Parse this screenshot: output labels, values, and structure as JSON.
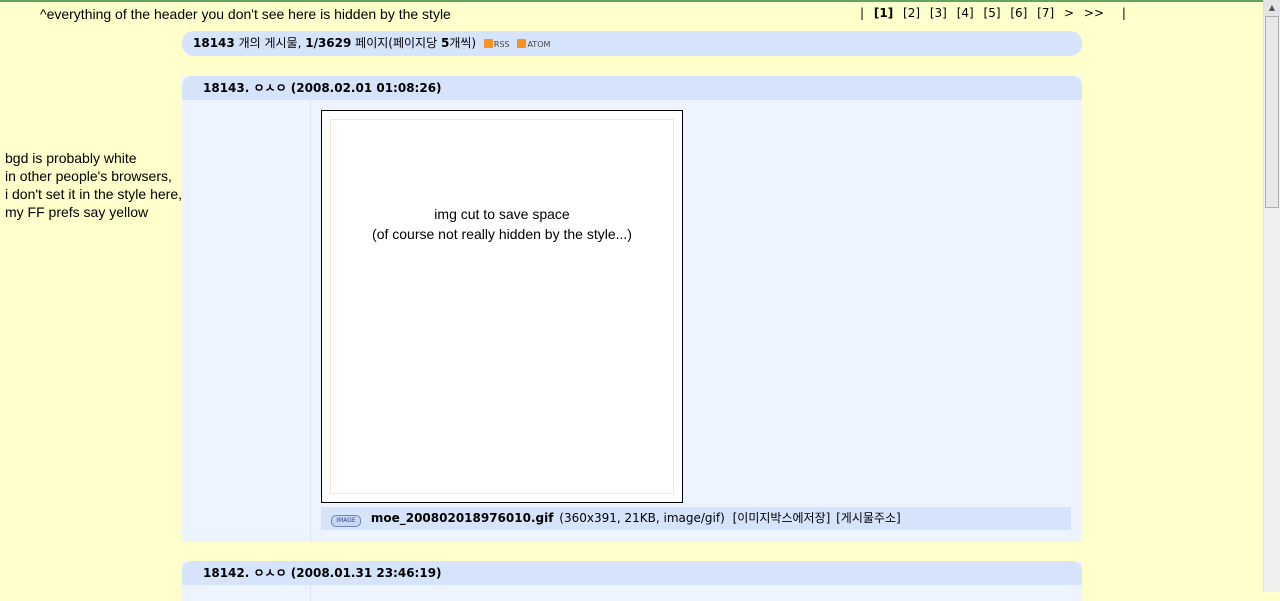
{
  "annotations": {
    "top_note": "^everything of the header you don't see here is hidden by the style",
    "left_note": [
      "bgd is probably white",
      "in other people's browsers,",
      "i don't set it in the style here,",
      "my FF prefs say yellow"
    ],
    "image_note_1": "img cut to save space",
    "image_note_2": "(of course not really hidden by the style...)"
  },
  "pager": {
    "bar": "|",
    "current": "[1]",
    "pages": [
      "[2]",
      "[3]",
      "[4]",
      "[5]",
      "[6]",
      "[7]"
    ],
    "next": ">",
    "last": ">>"
  },
  "summary": {
    "total": "18143",
    "total_suffix": " 개의 게시물, ",
    "page": "1/3629",
    "page_suffix": " 페이지(페이지당 ",
    "per_page": "5",
    "per_page_suffix": "개씩)",
    "rss": "RSS",
    "atom": "ATOM"
  },
  "posts": [
    {
      "header": "18143. ㅇㅅㅇ (2008.02.01 01:08:26)",
      "image": {
        "badge": "IMAGE",
        "filename": "moe_200802018976010.gif",
        "meta": "(360x391, 21KB, image/gif)",
        "save_action": "[이미지박스에저장]",
        "link_action": "[게시물주소]"
      }
    },
    {
      "header": "18142. ㅇㅅㅇ (2008.01.31 23:46:19)"
    }
  ],
  "colors": {
    "background": "#ffffcc",
    "header_blue": "#d5e3fb",
    "post_bg": "#eef4fd"
  }
}
